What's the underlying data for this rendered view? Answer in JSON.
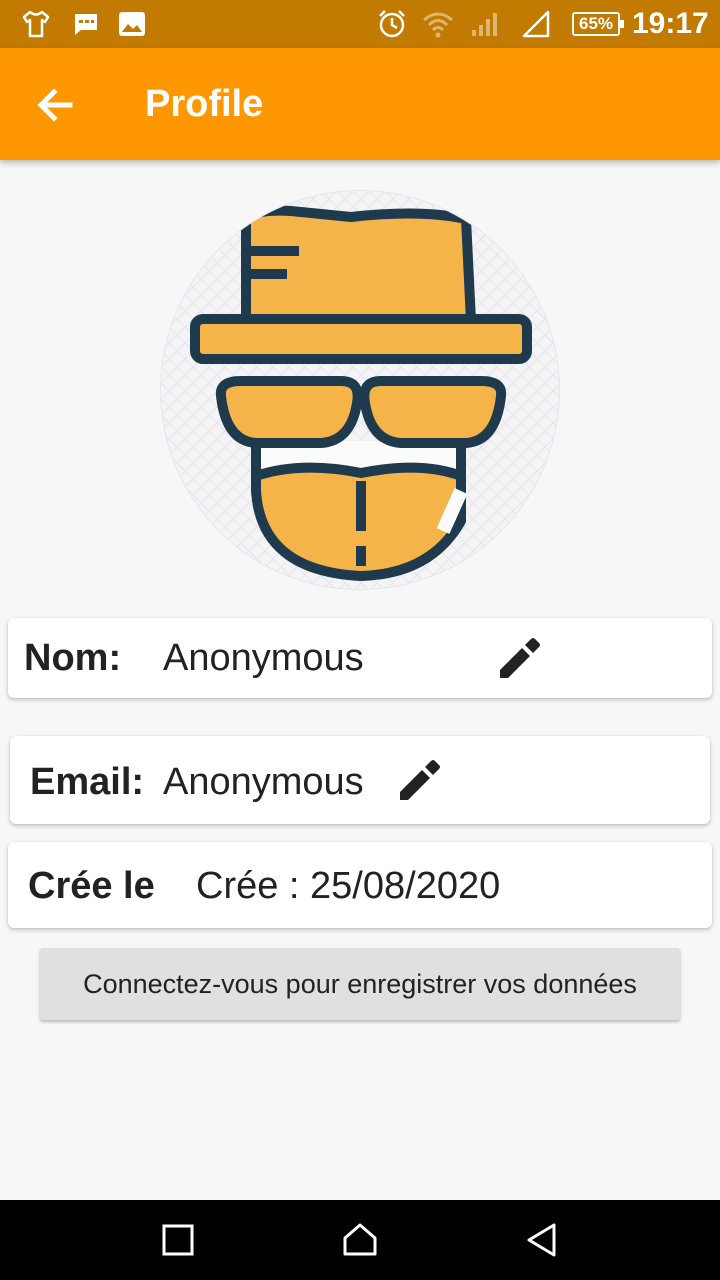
{
  "status_bar": {
    "battery": "65%",
    "time": "19:17",
    "icons": [
      "tshirt-icon",
      "message-icon",
      "image-icon",
      "alarm-icon",
      "wifi-icon",
      "signal-icon",
      "signal-full-icon",
      "battery-icon"
    ]
  },
  "app_bar": {
    "title": "Profile",
    "back_icon": "arrow-left-icon",
    "background": "#ff9800"
  },
  "avatar": {
    "icon": "detective-hat-glasses-avatar"
  },
  "fields": {
    "name": {
      "label": "Nom:",
      "value": "Anonymous",
      "icon": "pencil-icon"
    },
    "email": {
      "label": "Email:",
      "value": "Anonymous",
      "icon": "pencil-icon"
    },
    "created": {
      "label": "Crée le",
      "value": "Crée : 25/08/2020"
    }
  },
  "login_button": {
    "label": "Connectez-vous pour enregistrer vos données"
  },
  "nav_bar": {
    "icons": [
      "recent-apps-icon",
      "home-icon",
      "back-icon"
    ]
  },
  "colors": {
    "accent": "#ff9800",
    "status_bar": "#c27a00",
    "avatar_orange": "#f5b44a",
    "avatar_outline": "#1f3a4d"
  }
}
